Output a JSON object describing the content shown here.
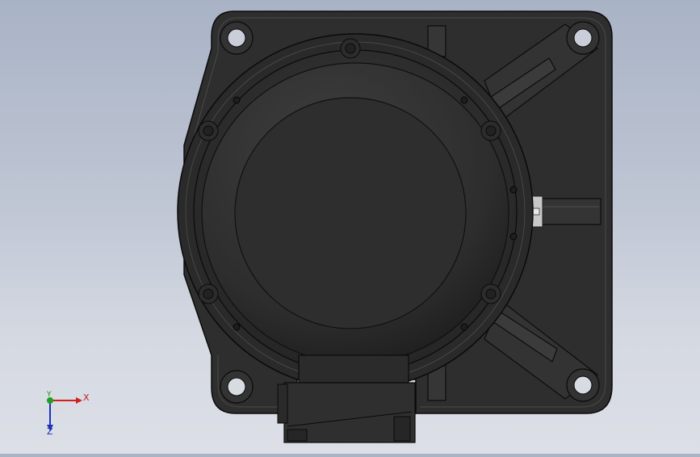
{
  "viewport": {
    "background_top": "#a9b3c6",
    "background_bottom": "#dcdfe6",
    "model_color": "#2d2d2d",
    "edge_color": "#0a0a0a"
  },
  "triad": {
    "x_label": "X",
    "y_label": "Y",
    "z_label": "Z",
    "x_color": "#d02020",
    "y_color": "#20a020",
    "z_color": "#2030c0"
  }
}
